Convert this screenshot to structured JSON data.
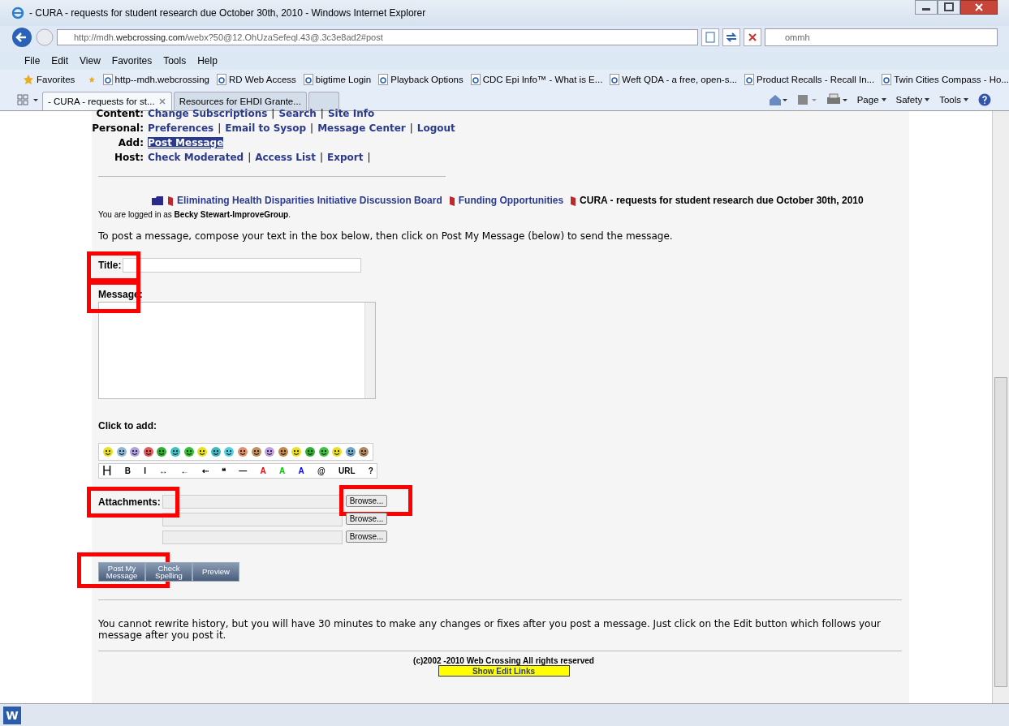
{
  "window": {
    "title": "- CURA - requests for student research due October 30th, 2010 - Windows Internet Explorer"
  },
  "address_bar": {
    "url_prefix": "http://mdh.",
    "url_domain": "webcrossing.com",
    "url_rest": "/webx?50@12.OhUzaSefeql.43@.3c3e8ad2#post"
  },
  "search_box": {
    "value": "ommh"
  },
  "menu": [
    "File",
    "Edit",
    "View",
    "Favorites",
    "Tools",
    "Help"
  ],
  "favorites_bar": {
    "label": "Favorites",
    "items": [
      "http--mdh.webcrossing",
      "RD Web Access",
      "bigtime Login",
      "Playback Options",
      "CDC  Epi Info™ - What is E...",
      "Weft QDA - a free, open-s...",
      "Product Recalls - Recall In...",
      "Twin Cities Compass - Ho..."
    ]
  },
  "tabs": [
    {
      "label": "- CURA - requests for st...",
      "selected": true
    },
    {
      "label": "Resources for EHDI Grante...",
      "selected": false
    }
  ],
  "command_bar": [
    "Page",
    "Safety",
    "Tools"
  ],
  "nav": [
    {
      "label": "Content:",
      "separators": [
        "|",
        "|"
      ],
      "links": [
        {
          "text": "Change Subscriptions",
          "selected": false
        },
        {
          "text": "Search",
          "selected": false
        },
        {
          "text": "Site Info",
          "selected": false
        }
      ]
    },
    {
      "label": "Personal:",
      "separators": [
        "|",
        "|",
        "|"
      ],
      "links": [
        {
          "text": "Preferences",
          "selected": false
        },
        {
          "text": "Email to Sysop",
          "selected": false
        },
        {
          "text": "Message Center",
          "selected": false
        },
        {
          "text": "Logout",
          "selected": false
        }
      ]
    },
    {
      "label": "Add:",
      "links": [
        {
          "text": "Post Message",
          "selected": true
        }
      ]
    },
    {
      "label": "Host:",
      "separators": [
        "|",
        "|",
        "|"
      ],
      "links": [
        {
          "text": "Check Moderated",
          "selected": false
        },
        {
          "text": "Access List",
          "selected": false
        },
        {
          "text": "Export",
          "selected": false
        }
      ]
    }
  ],
  "breadcrumb": {
    "links": [
      "Eliminating Health Disparities Initiative Discussion Board",
      "Funding Opportunities"
    ],
    "current": "CURA - requests for student research due October 30th, 2010"
  },
  "login_notice": "You are logged in as **Becky Stewart-ImproveGroup**.",
  "instructions": "To post a message, compose your text in the box below, then click on Post My Message (below) to send the message.",
  "form": {
    "title_label": "Title:",
    "message_label": "Message:",
    "click_to_add": "Click to add:",
    "smileys": [
      {
        "color": "#e8e020"
      },
      {
        "color": "#8fb8d8"
      },
      {
        "color": "#b0a0e0"
      },
      {
        "color": "#e05858"
      },
      {
        "color": "#30b030"
      },
      {
        "color": "#40c0c0"
      },
      {
        "color": "#30c030"
      },
      {
        "color": "#e8e020"
      },
      {
        "color": "#40b8c0"
      },
      {
        "color": "#50d0e0"
      },
      {
        "color": "#e09070"
      },
      {
        "color": "#c09060"
      },
      {
        "color": "#c0a0e0"
      },
      {
        "color": "#c08850"
      },
      {
        "color": "#e8e020"
      },
      {
        "color": "#30b030"
      },
      {
        "color": "#40c040"
      },
      {
        "color": "#e8e020"
      },
      {
        "color": "#70a8c8"
      },
      {
        "color": "#b08860"
      }
    ],
    "format_buttons": [
      {
        "glyph": "H"
      },
      {
        "glyph": "B"
      },
      {
        "glyph": "I"
      },
      {
        "glyph": "↔"
      },
      {
        "glyph": "←"
      },
      {
        "glyph": "⇠"
      },
      {
        "glyph": "❝"
      },
      {
        "glyph": "—"
      },
      {
        "glyph": "A",
        "color": "#ff0000"
      },
      {
        "glyph": "A",
        "color": "#00cc00"
      },
      {
        "glyph": "A",
        "color": "#0000ff"
      },
      {
        "glyph": "@"
      },
      {
        "glyph": "URL"
      },
      {
        "glyph": "?"
      }
    ],
    "attachments_label": "Attachments:",
    "browse_buttons": [
      "Browse...",
      "Browse...",
      "Browse..."
    ],
    "actions": [
      "Post My Message",
      "Check Spelling",
      "Preview"
    ]
  },
  "highlights": {
    "title_label": true,
    "message_label": true,
    "attachments_label": true,
    "first_browse": true,
    "post_button": true
  },
  "footer_notice": "You cannot rewrite history, but you will have 30 minutes to make any changes or fixes after you post a message. Just click on the Edit button which follows your message after you post it.",
  "copyright": "(c)2002 -2010 Web Crossing All rights reserved",
  "edit_links_button": "Show Edit Links",
  "taskbar": {
    "app_letter": "W"
  }
}
